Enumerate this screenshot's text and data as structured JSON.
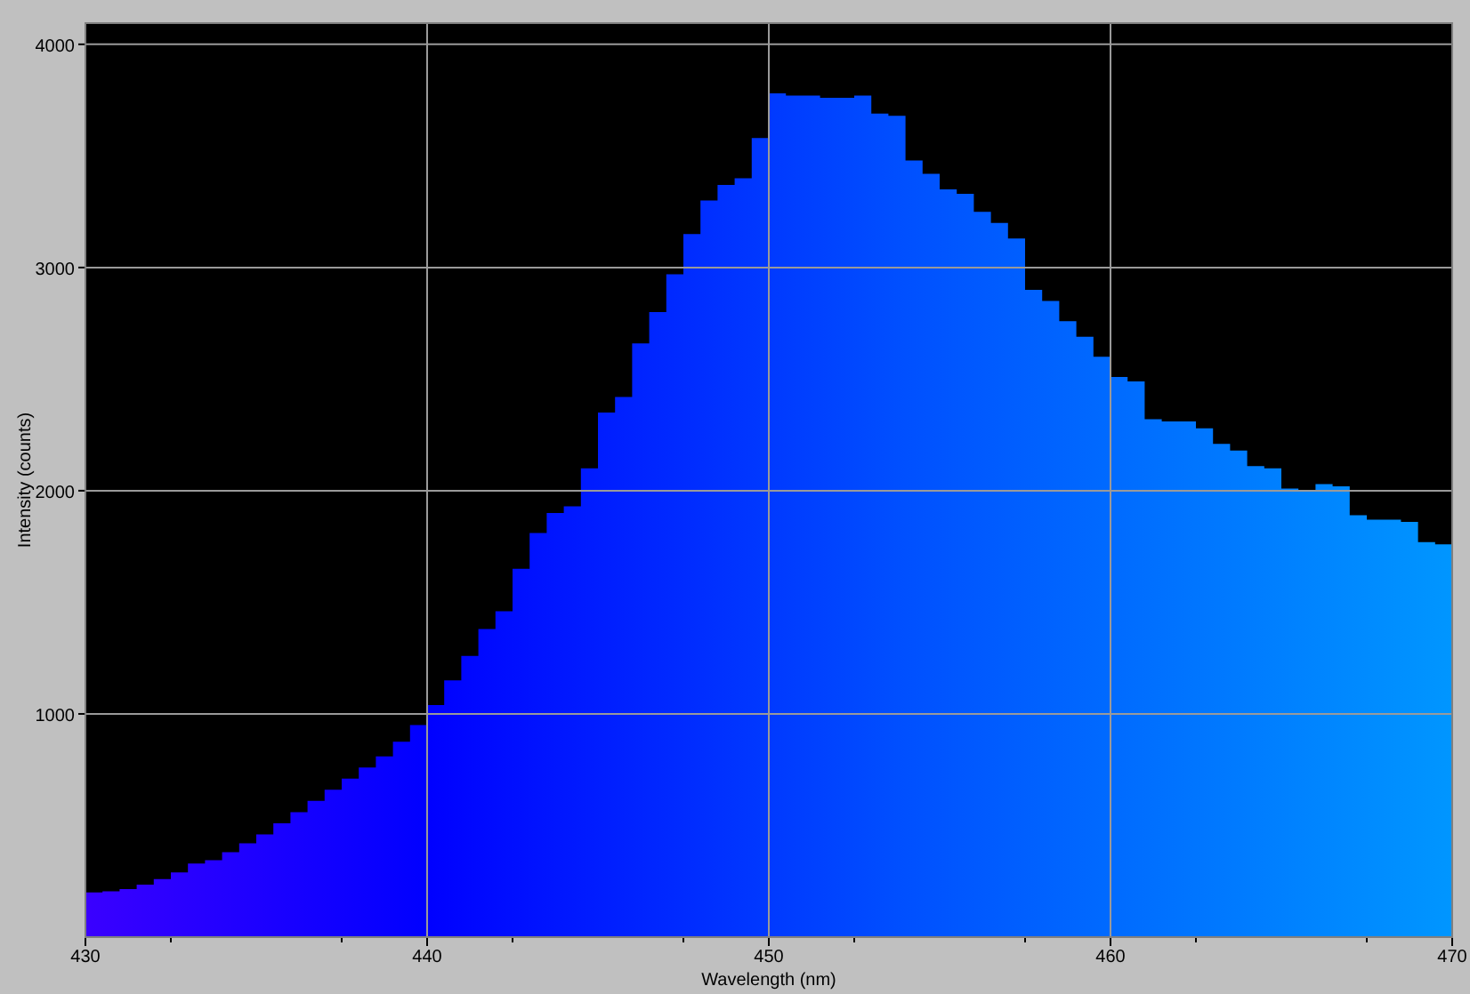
{
  "chart_data": {
    "type": "area",
    "xlabel": "Wavelength (nm)",
    "ylabel": "Intensity (counts)",
    "xlim": [
      430,
      470
    ],
    "ylim": [
      0,
      4095
    ],
    "xticks": [
      430,
      440,
      450,
      460,
      470
    ],
    "yticks": [
      1000,
      2000,
      3000,
      4000
    ],
    "grid": true,
    "x": [
      430,
      430.5,
      431,
      431.5,
      432,
      432.5,
      433,
      433.5,
      434,
      434.5,
      435,
      435.5,
      436,
      436.5,
      437,
      437.5,
      438,
      438.5,
      439,
      439.5,
      440,
      440.5,
      441,
      441.5,
      442,
      442.5,
      443,
      443.5,
      444,
      444.5,
      445,
      445.5,
      446,
      446.5,
      447,
      447.5,
      448,
      448.5,
      449,
      449.5,
      450,
      450.5,
      451,
      451.5,
      452,
      452.5,
      453,
      453.5,
      454,
      454.5,
      455,
      455.5,
      456,
      456.5,
      457,
      457.5,
      458,
      458.5,
      459,
      459.5,
      460,
      460.5,
      461,
      461.5,
      462,
      462.5,
      463,
      463.5,
      464,
      464.5,
      465,
      465.5,
      466,
      466.5,
      467,
      467.5,
      468,
      468.5,
      469,
      469.5,
      470
    ],
    "series": [
      {
        "color": "#0050ff",
        "values": [
          200,
          205,
          215,
          235,
          260,
          290,
          330,
          345,
          380,
          420,
          460,
          510,
          560,
          610,
          660,
          710,
          760,
          810,
          875,
          950,
          1040,
          1150,
          1260,
          1380,
          1460,
          1650,
          1810,
          1900,
          1930,
          2100,
          2350,
          2420,
          2660,
          2800,
          2970,
          3150,
          3300,
          3370,
          3400,
          3580,
          3780,
          3770,
          3770,
          3760,
          3760,
          3770,
          3690,
          3680,
          3480,
          3420,
          3350,
          3330,
          3250,
          3200,
          3130,
          2900,
          2850,
          2760,
          2690,
          2600,
          2510,
          2490,
          2320,
          2310,
          2310,
          2280,
          2210,
          2180,
          2110,
          2100,
          2010,
          2000,
          2030,
          2020,
          1890,
          1870,
          1870,
          1860,
          1770,
          1760,
          1760
        ]
      }
    ]
  }
}
